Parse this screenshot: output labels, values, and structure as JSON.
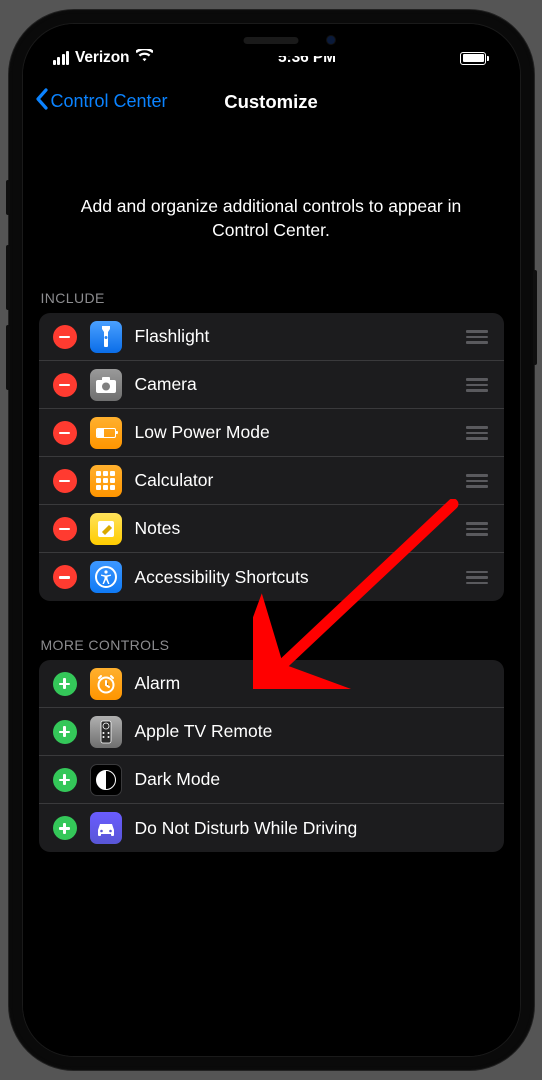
{
  "status": {
    "carrier": "Verizon",
    "time": "5:36 PM"
  },
  "nav": {
    "back_label": "Control Center",
    "title": "Customize"
  },
  "description": "Add and organize additional controls to appear in Control Center.",
  "sections": {
    "include": {
      "header": "INCLUDE",
      "items": [
        {
          "label": "Flashlight",
          "icon": "flashlight-icon"
        },
        {
          "label": "Camera",
          "icon": "camera-icon"
        },
        {
          "label": "Low Power Mode",
          "icon": "low-power-icon"
        },
        {
          "label": "Calculator",
          "icon": "calculator-icon"
        },
        {
          "label": "Notes",
          "icon": "notes-icon"
        },
        {
          "label": "Accessibility Shortcuts",
          "icon": "accessibility-icon"
        }
      ]
    },
    "more": {
      "header": "MORE CONTROLS",
      "items": [
        {
          "label": "Alarm",
          "icon": "alarm-icon"
        },
        {
          "label": "Apple TV Remote",
          "icon": "apple-tv-remote-icon"
        },
        {
          "label": "Dark Mode",
          "icon": "dark-mode-icon"
        },
        {
          "label": "Do Not Disturb While Driving",
          "icon": "dnd-driving-icon"
        }
      ]
    }
  },
  "annotation": {
    "type": "arrow",
    "target": "Accessibility Shortcuts",
    "color": "#ff0000"
  }
}
